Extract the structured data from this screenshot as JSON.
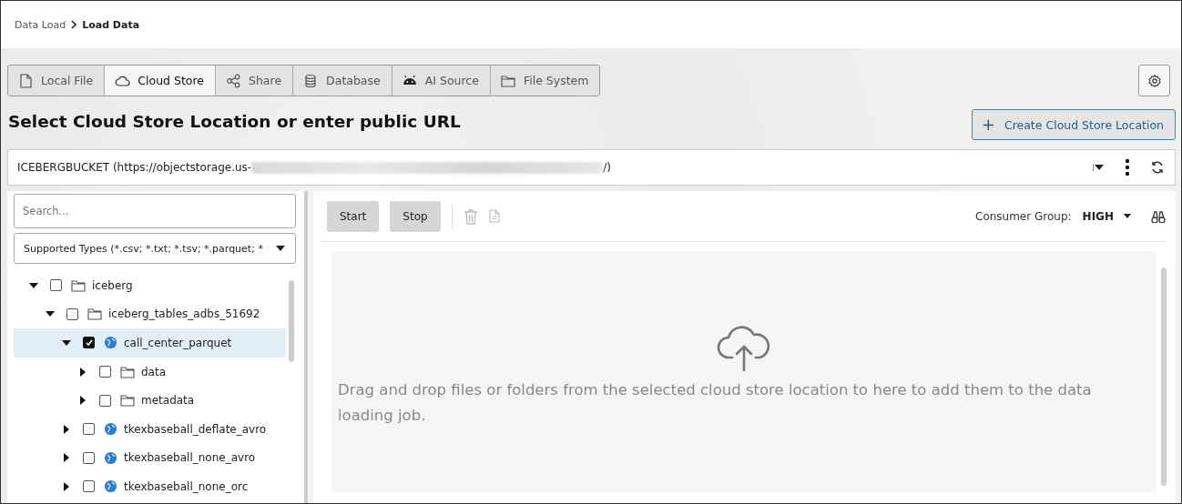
{
  "breadcrumb": [
    {
      "label": "Data Load",
      "current": false
    },
    {
      "label": "Load Data",
      "current": true
    }
  ],
  "tabs": [
    {
      "label": "Local File",
      "kind": "file",
      "selected": false
    },
    {
      "label": "Cloud Store",
      "kind": "cloud",
      "selected": true
    },
    {
      "label": "Share",
      "kind": "share",
      "selected": false
    },
    {
      "label": "Database",
      "kind": "database",
      "selected": false
    },
    {
      "label": "AI Source",
      "kind": "android",
      "selected": false
    },
    {
      "label": "File System",
      "kind": "folder",
      "selected": false
    }
  ],
  "heading": "Select Cloud Store Location or enter public URL",
  "create_button": {
    "label": "Create Cloud Store Location",
    "icon": "+"
  },
  "location": {
    "value_start": "ICEBERGBUCKET (https://objectstorage.us-",
    "value_end": "/)"
  },
  "search": {
    "placeholder": "Search..."
  },
  "type_filter": {
    "value": "Supported Types (*.csv; *.txt; *.tsv; *.parquet; *"
  },
  "tree": [
    {
      "label": "iceberg",
      "kind": "folder",
      "expanded": true,
      "checked": false,
      "selected": false,
      "children": [
        {
          "label": "iceberg_tables_adbs_51692",
          "kind": "folder",
          "expanded": true,
          "checked": false,
          "selected": false,
          "children": [
            {
              "label": "call_center_parquet",
              "kind": "table",
              "expanded": true,
              "checked": true,
              "selected": true,
              "children": [
                {
                  "label": "data",
                  "kind": "folder",
                  "expanded": false,
                  "checked": false,
                  "selected": false
                },
                {
                  "label": "metadata",
                  "kind": "folder",
                  "expanded": false,
                  "checked": false,
                  "selected": false
                }
              ]
            },
            {
              "label": "tkexbaseball_deflate_avro",
              "kind": "table",
              "expanded": false,
              "checked": false,
              "selected": false
            },
            {
              "label": "tkexbaseball_none_avro",
              "kind": "table",
              "expanded": false,
              "checked": false,
              "selected": false
            },
            {
              "label": "tkexbaseball_none_orc",
              "kind": "table",
              "expanded": false,
              "checked": false,
              "selected": false
            }
          ]
        }
      ]
    }
  ],
  "toolbar": {
    "start": "Start",
    "stop": "Stop",
    "consumer_label": "Consumer Group:",
    "consumer_value": "HIGH"
  },
  "drop_message": "Drag and drop files or folders from the selected cloud store location to here to add them to the data loading job."
}
